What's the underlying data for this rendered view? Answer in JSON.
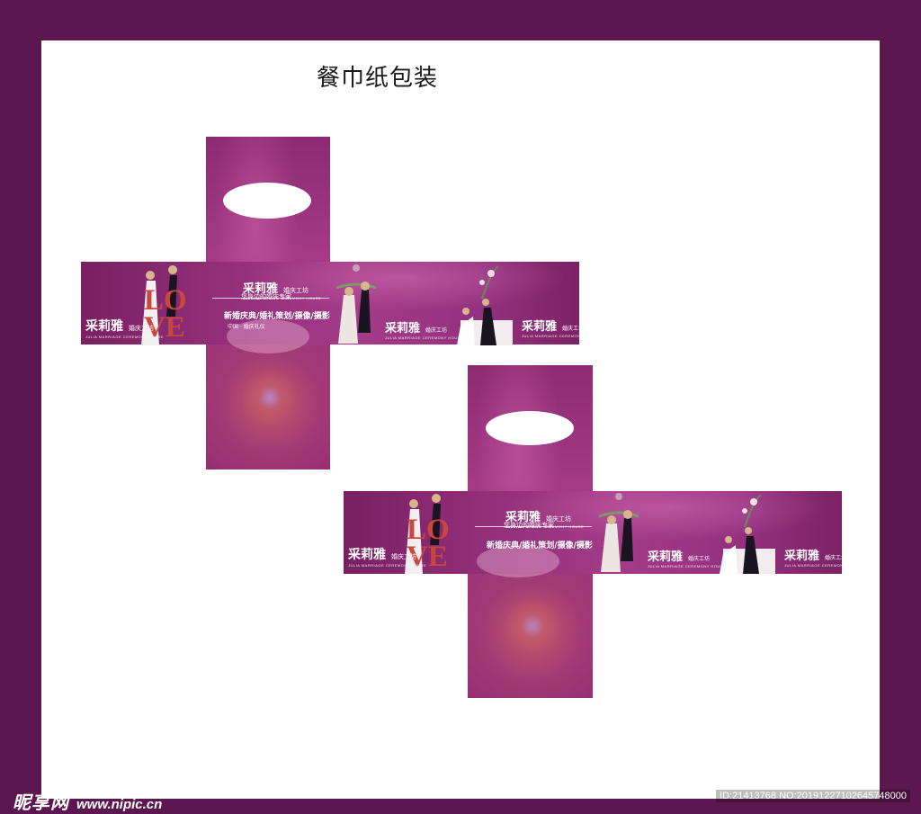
{
  "page": {
    "title": "餐巾纸包装"
  },
  "colors": {
    "frame": "#5c1650",
    "panel": "#a33b88",
    "love_letters": "#c9483e"
  },
  "box_design": {
    "brand_name": "采莉雅",
    "brand_sub": "婚庆工坊",
    "brand_en": "JULIA MARRIAGE CEREMONY HOUSE",
    "tagline": "您身边的婚庆专家",
    "services": "新婚庆典/婚礼策划/摄像/摄影",
    "china_line": "中国 · 婚庆礼仪",
    "love_text": "LOVE"
  },
  "watermark": {
    "site_logo": "昵享网",
    "site_url": "www.nipic.cn",
    "image_id": "ID:21413768 NO:20191227102645748000"
  }
}
